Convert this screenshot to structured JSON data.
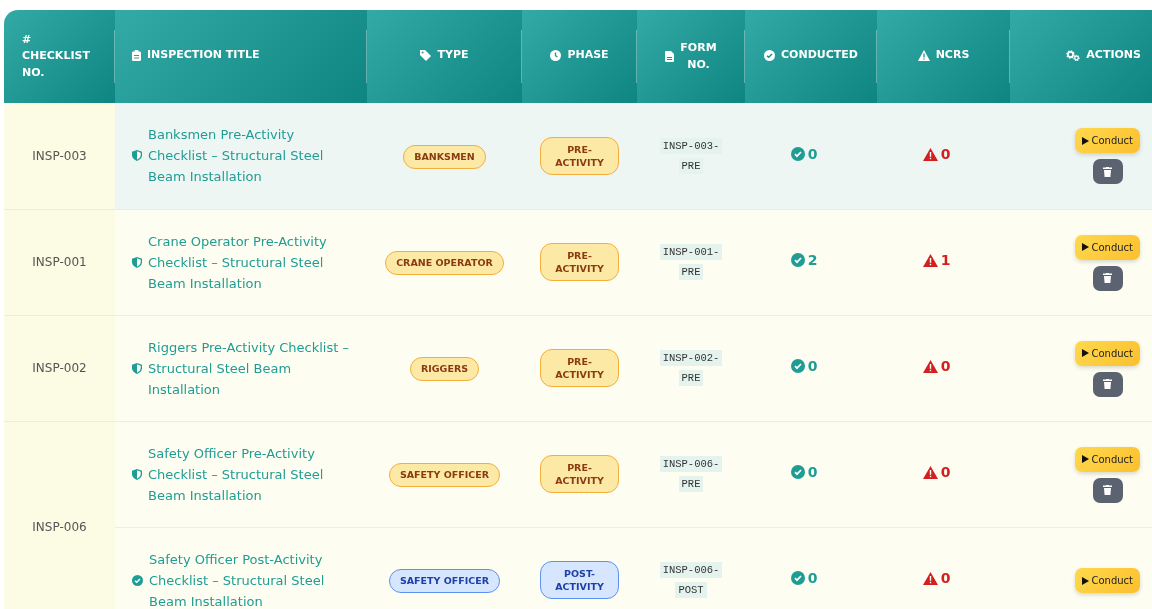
{
  "table": {
    "columns": [
      {
        "symbol": "#",
        "label": "CHECKLIST NO."
      },
      {
        "label": "INSPECTION TITLE"
      },
      {
        "label": "TYPE"
      },
      {
        "label": "PHASE"
      },
      {
        "label": "FORM NO."
      },
      {
        "label": "CONDUCTED"
      },
      {
        "label": "NCRS"
      },
      {
        "label": "ACTIONS"
      }
    ],
    "groups": [
      {
        "checklist_no": "INSP-003",
        "inspections": [
          {
            "kind": "pre",
            "highlighted": true,
            "title": "Banksmen Pre-Activity Checklist – Structural Steel Beam Installation",
            "type": "BANKSMEN",
            "phase": "PRE-ACTIVITY",
            "form_no": "INSP-003-PRE",
            "conducted": "0",
            "ncrs": "0",
            "conduct_label": "Conduct",
            "deletable": true
          }
        ]
      },
      {
        "checklist_no": "INSP-001",
        "inspections": [
          {
            "kind": "pre",
            "highlighted": false,
            "title": "Crane Operator Pre-Activity Checklist – Structural Steel Beam Installation",
            "type": "CRANE OPERATOR",
            "phase": "PRE-ACTIVITY",
            "form_no": "INSP-001-PRE",
            "conducted": "2",
            "ncrs": "1",
            "conduct_label": "Conduct",
            "deletable": true
          }
        ]
      },
      {
        "checklist_no": "INSP-002",
        "inspections": [
          {
            "kind": "pre",
            "highlighted": false,
            "title": "Riggers Pre-Activity Checklist – Structural Steel Beam Installation",
            "type": "RIGGERS",
            "phase": "PRE-ACTIVITY",
            "form_no": "INSP-002-PRE",
            "conducted": "0",
            "ncrs": "0",
            "conduct_label": "Conduct",
            "deletable": true
          }
        ]
      },
      {
        "checklist_no": "INSP-006",
        "inspections": [
          {
            "kind": "pre",
            "highlighted": false,
            "title": "Safety Officer Pre-Activity Checklist – Structural Steel Beam Installation",
            "type": "SAFETY OFFICER",
            "phase": "PRE-ACTIVITY",
            "form_no": "INSP-006-PRE",
            "conducted": "0",
            "ncrs": "0",
            "conduct_label": "Conduct",
            "deletable": true
          },
          {
            "kind": "post",
            "highlighted": false,
            "title": "Safety Officer Post-Activity Checklist – Structural Steel Beam Installation",
            "type": "SAFETY OFFICER",
            "phase": "POST-ACTIVITY",
            "form_no": "INSP-006-POST",
            "conducted": "0",
            "ncrs": "0",
            "conduct_label": "Conduct",
            "deletable": false
          }
        ]
      }
    ]
  }
}
